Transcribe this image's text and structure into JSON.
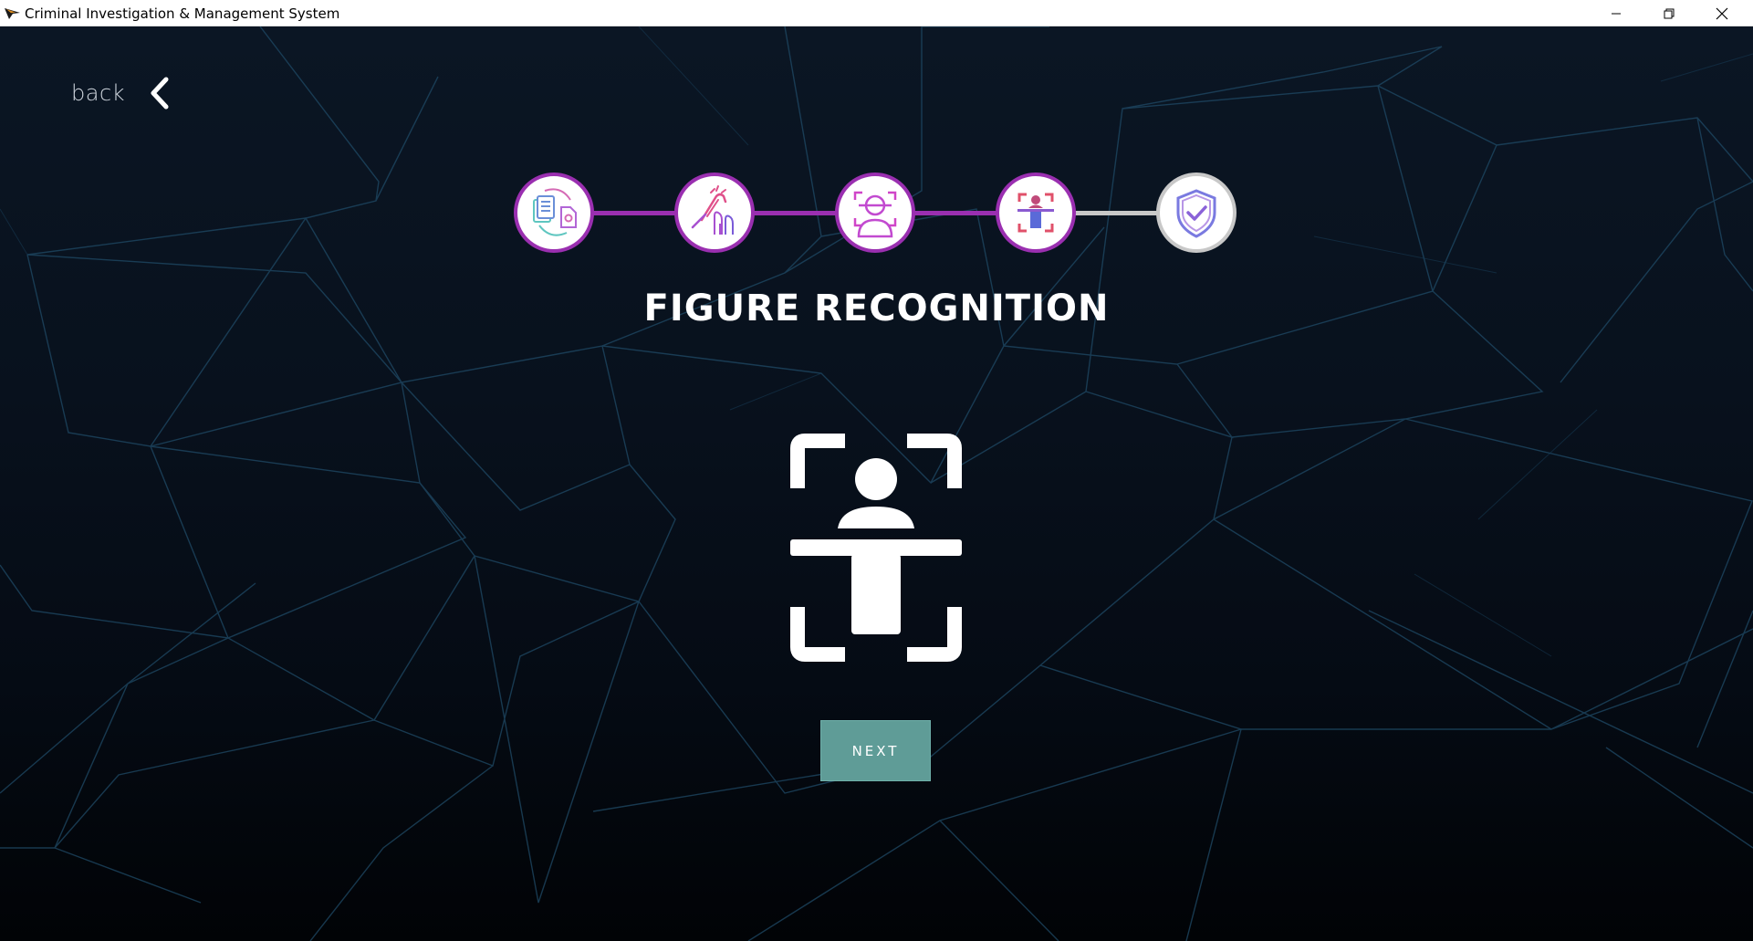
{
  "window": {
    "title": "Criminal Investigation & Management System",
    "controls": [
      "minimize-icon",
      "restore-icon",
      "close-icon"
    ]
  },
  "nav": {
    "back_label": "back",
    "back_icon": "chevron-left-icon"
  },
  "steps": [
    {
      "icon": "documents-sync-icon",
      "status": "completed"
    },
    {
      "icon": "fingerprint-hand-icon",
      "status": "completed"
    },
    {
      "icon": "face-scan-icon",
      "status": "completed"
    },
    {
      "icon": "figure-scan-icon",
      "status": "current"
    },
    {
      "icon": "shield-check-icon",
      "status": "pending"
    }
  ],
  "main": {
    "title": "FIGURE RECOGNITION",
    "hero_icon": "figure-scan-icon",
    "next_label": "NEXT"
  },
  "colors": {
    "step_active": "#9a2fb0",
    "step_pending": "#c8c8c8",
    "button": "#5f9c97",
    "background": "#08111d"
  }
}
